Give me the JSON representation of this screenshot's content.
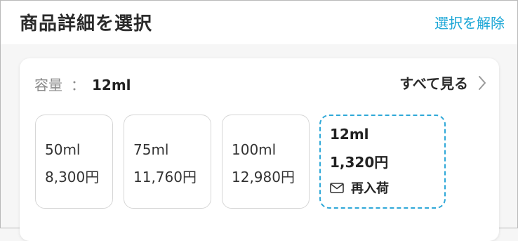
{
  "header": {
    "title": "商品詳細を選択",
    "clear_label": "選択を解除"
  },
  "capacity": {
    "label": "容量",
    "separator": "：",
    "value": "12ml",
    "see_all_label": "すべて見る"
  },
  "options": [
    {
      "name": "50ml",
      "price": "8,300円"
    },
    {
      "name": "75ml",
      "price": "11,760円"
    },
    {
      "name": "100ml",
      "price": "12,980円"
    },
    {
      "name": "12ml",
      "price": "1,320円",
      "restock_label": "再入荷",
      "selected": true
    }
  ],
  "colors": {
    "accent": "#1aa6d6",
    "selected_border": "#2fa8d8",
    "muted_text": "#8a8a8a"
  },
  "icons": {
    "see_all": "chevron-right-icon",
    "restock": "mail-icon"
  }
}
